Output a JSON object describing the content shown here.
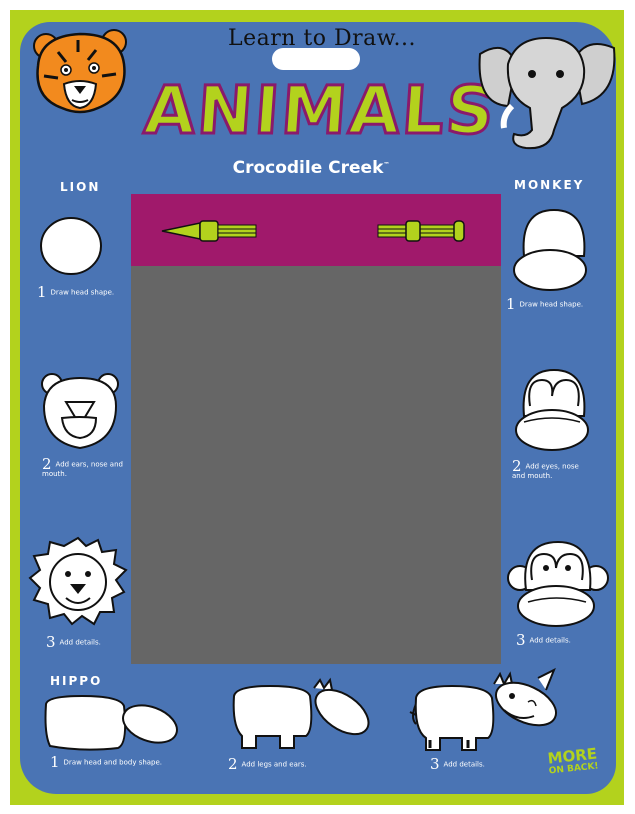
{
  "header": {
    "subtitle": "Learn to Draw...",
    "title": "ANIMALS",
    "brand": "Crocodile Creek",
    "brand_mark": "™"
  },
  "sections": {
    "lion": {
      "heading": "LION",
      "steps": [
        {
          "num": "1",
          "text": "Draw head shape."
        },
        {
          "num": "2",
          "text": "Add ears, nose and mouth."
        },
        {
          "num": "3",
          "text": "Add details."
        }
      ]
    },
    "monkey": {
      "heading": "MONKEY",
      "steps": [
        {
          "num": "1",
          "text": "Draw head shape."
        },
        {
          "num": "2",
          "text": "Add eyes, nose and mouth."
        },
        {
          "num": "3",
          "text": "Add details."
        }
      ]
    },
    "hippo": {
      "heading": "HIPPO",
      "steps": [
        {
          "num": "1",
          "text": "Draw head and body shape."
        },
        {
          "num": "2",
          "text": "Add legs and ears."
        },
        {
          "num": "3",
          "text": "Add details."
        }
      ]
    }
  },
  "more": {
    "line1": "MORE",
    "line2": "ON BACK!"
  },
  "colors": {
    "lime": "#b3d21d",
    "blue": "#4a74b4",
    "magenta": "#a0196b",
    "screen": "#666666",
    "tiger": "#f28a1e"
  },
  "icons": [
    "tiger-icon",
    "elephant-icon",
    "stylus-icon",
    "slider-icon"
  ]
}
